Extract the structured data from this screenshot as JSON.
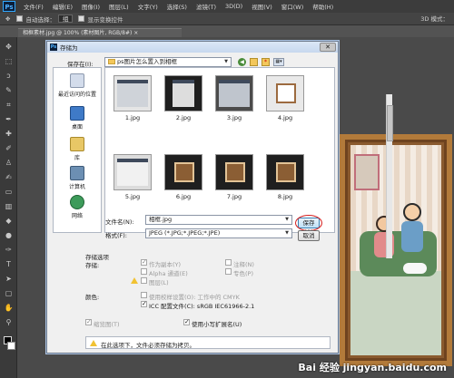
{
  "app": {
    "logo": "Ps",
    "menu": [
      "文件(F)",
      "编辑(E)",
      "图像(I)",
      "图层(L)",
      "文字(Y)",
      "选择(S)",
      "滤镜(T)",
      "3D(D)",
      "视图(V)",
      "窗口(W)",
      "帮助(H)"
    ],
    "options_bar": {
      "auto_select_label": "自动选择：",
      "auto_select_value": "组",
      "show_transform_label": "显示变换控件",
      "mode_3d": "3D 模式："
    },
    "doc_tab": "相框素材.jpg @ 100% (素材图片, RGB/8#) ×"
  },
  "dialog": {
    "title": "存储为",
    "save_in_label": "保存在(I):",
    "save_in_value": "ps图片怎么置入到相框",
    "places": [
      "最近访问的位置",
      "桌面",
      "库",
      "计算机",
      "网络"
    ],
    "files": [
      "1.jpg",
      "2.jpg",
      "3.jpg",
      "4.jpg",
      "5.jpg",
      "6.jpg",
      "7.jpg",
      "8.jpg"
    ],
    "filename_label": "文件名(N):",
    "filename_value": "相框.jpg",
    "format_label": "格式(F):",
    "format_value": "JPEG (*.JPG;*.JPEG;*.JPE)",
    "save_button": "保存(S)",
    "cancel_button": "取消",
    "options": {
      "section_title": "存储选项",
      "store_label": "存储:",
      "as_copy": "作为副本(Y)",
      "notes": "注释(N)",
      "alpha": "Alpha 通道(E)",
      "spot": "专色(P)",
      "layers": "图层(L)",
      "color_label": "颜色:",
      "proof": "使用校样设置(O): 工作中的 CMYK",
      "icc": "ICC 配置文件(C): sRGB IEC61966-2.1",
      "thumbnail": "缩览图(T)",
      "lowercase": "使用小写扩展名(U)"
    },
    "warning": "在此选项下，文件必须存储为拷贝。"
  },
  "watermark": "Bai 经验 jingyan.baidu.com",
  "colors": {
    "accent": "#3c7fb1",
    "highlight_circle": "#d52020"
  }
}
